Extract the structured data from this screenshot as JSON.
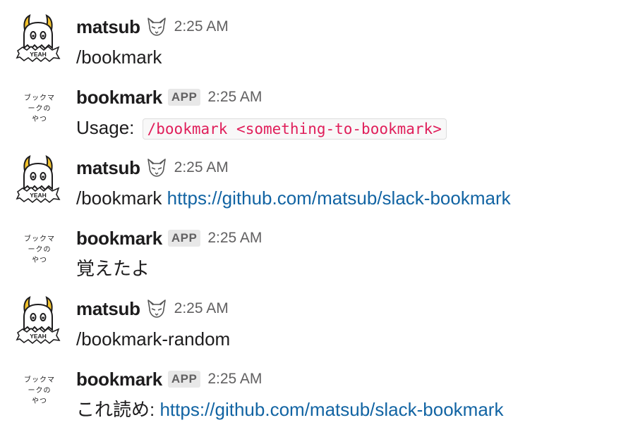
{
  "messages": [
    {
      "sender": "matsub",
      "sender_kind": "user",
      "status_emoji": "fox-face-icon",
      "time": "2:25 AM",
      "text": "/bookmark",
      "avatar_caption": "YEAH"
    },
    {
      "sender": "bookmark",
      "sender_kind": "app",
      "badge": "APP",
      "time": "2:25 AM",
      "text": "Usage:",
      "code": "/bookmark <something-to-bookmark>",
      "avatar_lines": [
        "ブックマ",
        "ークの",
        "やつ"
      ]
    },
    {
      "sender": "matsub",
      "sender_kind": "user",
      "status_emoji": "fox-face-icon",
      "time": "2:25 AM",
      "text": "/bookmark",
      "link": "https://github.com/matsub/slack-bookmark",
      "avatar_caption": "YEAH"
    },
    {
      "sender": "bookmark",
      "sender_kind": "app",
      "badge": "APP",
      "time": "2:25 AM",
      "text": "覚えたよ",
      "avatar_lines": [
        "ブックマ",
        "ークの",
        "やつ"
      ]
    },
    {
      "sender": "matsub",
      "sender_kind": "user",
      "status_emoji": "fox-face-icon",
      "time": "2:25 AM",
      "text": "/bookmark-random",
      "avatar_caption": "YEAH"
    },
    {
      "sender": "bookmark",
      "sender_kind": "app",
      "badge": "APP",
      "time": "2:25 AM",
      "text": "これ読め:",
      "link": "https://github.com/matsub/slack-bookmark",
      "avatar_lines": [
        "ブックマ",
        "ークの",
        "やつ"
      ]
    }
  ],
  "colors": {
    "link": "#1264a3",
    "code_text": "#e01e5a",
    "time": "#616061",
    "horn": "#f2c22b"
  }
}
